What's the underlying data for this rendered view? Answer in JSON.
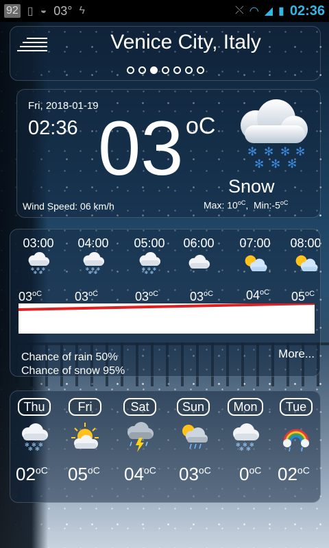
{
  "statusbar": {
    "battery_level": "92",
    "temp": "03°",
    "time": "02:36"
  },
  "header": {
    "city": "Venice City, Italy",
    "page_count": 7,
    "active_page_index": 2
  },
  "current": {
    "date": "Fri, 2018-01-19",
    "time": "02:36",
    "temp": "03",
    "unit": "oC",
    "condition": "Snow",
    "icon": "snow-cloud-icon",
    "wind": "Wind Speed: 06 km/h",
    "max_label": "Max: 10",
    "min_label": "Min:-5",
    "max_unit": "oC",
    "min_unit": "oC"
  },
  "hourly": {
    "hours": [
      {
        "time": "03:00",
        "temp": "03",
        "unit": "oC",
        "icon": "snow-cloud-icon"
      },
      {
        "time": "04:00",
        "temp": "03",
        "unit": "oC",
        "icon": "snow-cloud-icon"
      },
      {
        "time": "05:00",
        "temp": "03",
        "unit": "oC",
        "icon": "snow-cloud-icon"
      },
      {
        "time": "06:00",
        "temp": "03",
        "unit": "oC",
        "icon": "cloud-icon"
      },
      {
        "time": "07:00",
        "temp": "04",
        "unit": "oC",
        "icon": "partly-sunny-icon"
      },
      {
        "time": "08:00",
        "temp": "05",
        "unit": "oC",
        "icon": "partly-sunny-icon"
      }
    ],
    "chance_rain": "Chance of rain  50%",
    "chance_snow": "Chance of snow  95%",
    "more_label": "More..."
  },
  "daily": {
    "days": [
      {
        "label": "Thu",
        "temp": "02",
        "unit": "oC",
        "icon": "snow-cloud-icon"
      },
      {
        "label": "Fri",
        "temp": "05",
        "unit": "oC",
        "icon": "sun-cloud-icon"
      },
      {
        "label": "Sat",
        "temp": "04",
        "unit": "oC",
        "icon": "thunder-storm-icon"
      },
      {
        "label": "Sun",
        "temp": "03",
        "unit": "oC",
        "icon": "sun-rain-icon"
      },
      {
        "label": "Mon",
        "temp": "0",
        "unit": "oC",
        "icon": "snow-cloud-icon"
      },
      {
        "label": "Tue",
        "temp": "02",
        "unit": "oC",
        "icon": "rainbow-cloud-icon"
      }
    ]
  },
  "colors": {
    "accent": "#33b5e5",
    "graph_line": "#e02020"
  }
}
